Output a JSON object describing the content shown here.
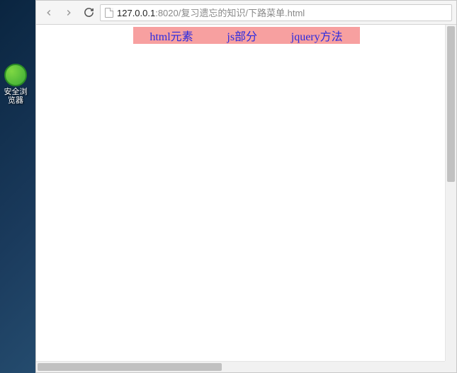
{
  "desktop": {
    "browser_shortcut_label": "安全浏览器"
  },
  "toolbar": {
    "url_host": "127.0.0.1",
    "url_port": ":8020",
    "url_path": "/复习遗忘的知识/下路菜单.html"
  },
  "page": {
    "menu_items": [
      "html元素",
      "js部分",
      "jquery方法"
    ]
  }
}
